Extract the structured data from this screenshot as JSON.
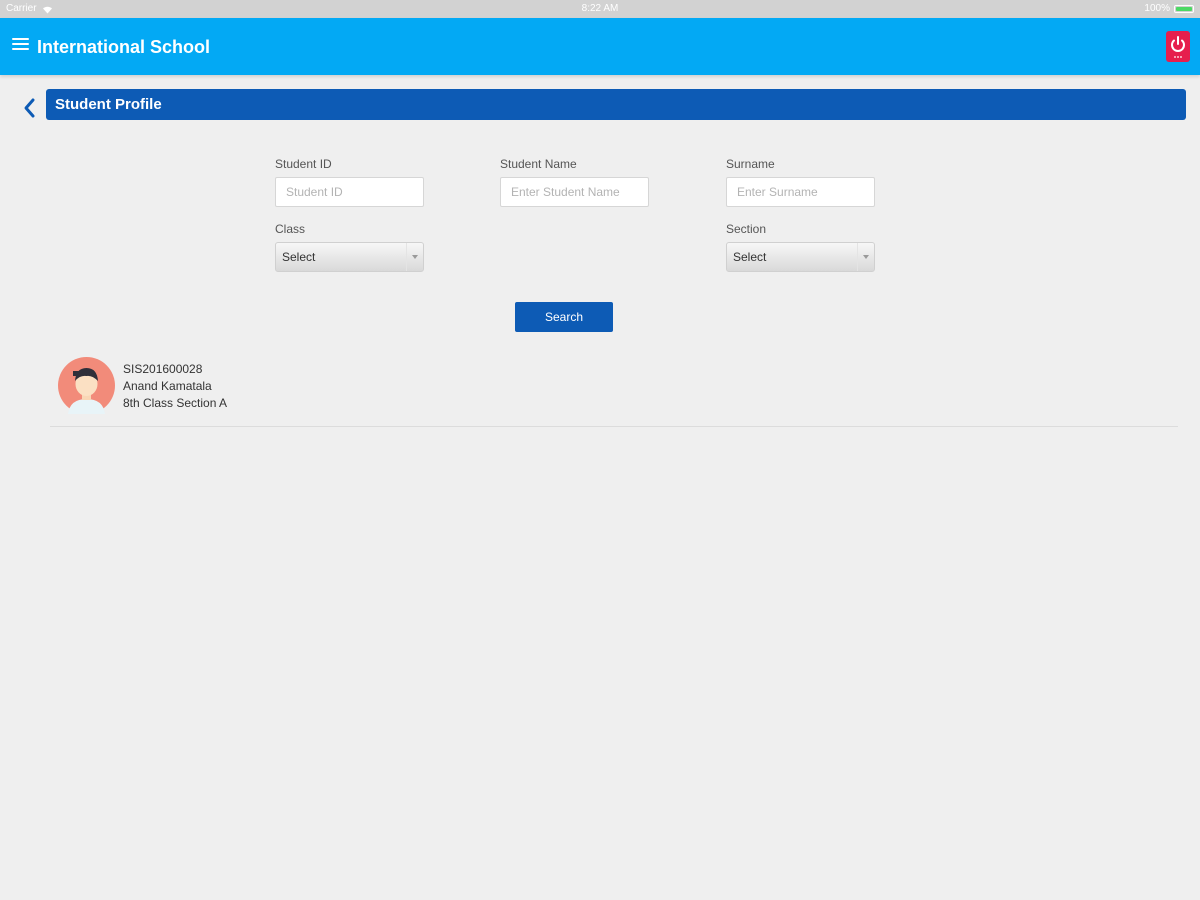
{
  "status_bar": {
    "carrier": "Carrier",
    "time": "8:22 AM",
    "battery": "100%",
    "battery_level": 1.0,
    "battery_color": "#4cd964"
  },
  "header": {
    "title": "International School",
    "menu_icon": "hamburger-icon",
    "power_icon": "power-icon",
    "background": "#03a9f4",
    "power_color": "#e61e4d"
  },
  "section": {
    "title": "Student Profile",
    "back_icon": "chevron-left-icon",
    "color": "#0d5bb5"
  },
  "form": {
    "student_id": {
      "label": "Student ID",
      "placeholder": "Student ID",
      "value": ""
    },
    "student_name": {
      "label": "Student Name",
      "placeholder": "Enter Student Name",
      "value": ""
    },
    "surname": {
      "label": "Surname",
      "placeholder": "Enter Surname",
      "value": ""
    },
    "class": {
      "label": "Class",
      "selected": "Select"
    },
    "section": {
      "label": "Section",
      "selected": "Select"
    },
    "search_label": "Search"
  },
  "results": [
    {
      "id": "SIS201600028",
      "name": "Anand Kamatala",
      "class_section": "8th Class Section A",
      "avatar_icon": "student-avatar-icon"
    }
  ]
}
